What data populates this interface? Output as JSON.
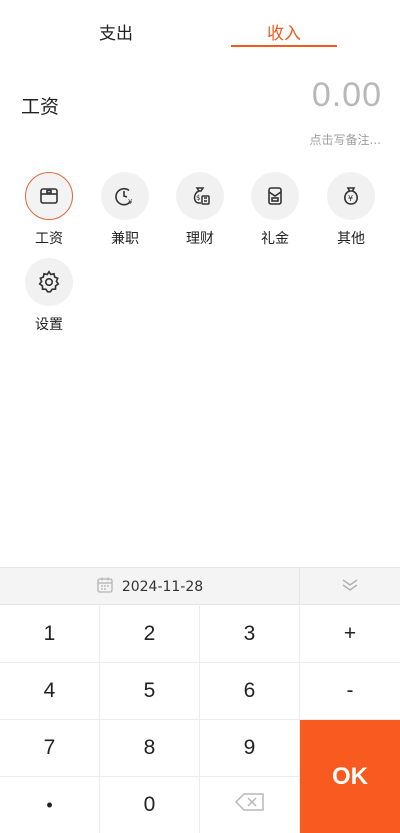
{
  "tabs": [
    {
      "label": "支出",
      "active": false
    },
    {
      "label": "收入",
      "active": true
    }
  ],
  "accent_color": "#f25a22",
  "entry": {
    "category": "工资",
    "amount": "0.00",
    "memo_placeholder": "点击写备注..."
  },
  "categories": [
    {
      "label": "工资",
      "icon": "wallet-icon",
      "selected": true
    },
    {
      "label": "兼职",
      "icon": "clock-yen-icon",
      "selected": false
    },
    {
      "label": "理财",
      "icon": "money-bag-icon",
      "selected": false
    },
    {
      "label": "礼金",
      "icon": "gift-envelope-icon",
      "selected": false
    },
    {
      "label": "其他",
      "icon": "yen-bag-icon",
      "selected": false
    },
    {
      "label": "设置",
      "icon": "gear-icon",
      "selected": false
    }
  ],
  "keypad": {
    "date": "2024-11-28",
    "keys": [
      "1",
      "2",
      "3",
      "+",
      "4",
      "5",
      "6",
      "-",
      "7",
      "8",
      "9",
      "•",
      "0"
    ],
    "ok_label": "OK",
    "ok_color": "#f95a1f"
  }
}
